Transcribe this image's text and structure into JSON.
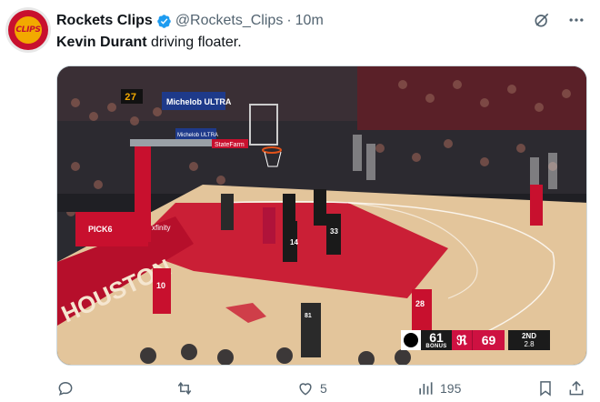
{
  "account": {
    "display_name": "Rockets Clips",
    "handle": "@Rockets_Clips",
    "separator": "·",
    "timestamp": "10m",
    "avatar_text": "CLIPS",
    "verified": true
  },
  "tweet": {
    "bold_text": "Kevin Durant",
    "rest_text": " driving floater."
  },
  "media": {
    "type": "video-frame",
    "arena_signs": {
      "sign1": "Michelob ULTRA",
      "sign2": "Michelob ULTRA",
      "sign3": "StateFarm",
      "shot_clock": "27",
      "baseline": "HOUSTON",
      "pick6": "PICK6",
      "sponsor_side": "xfinity"
    },
    "jerseys": [
      "10",
      "14",
      "33",
      "28",
      "81"
    ],
    "scorebug": {
      "away_score": "61",
      "away_bonus": "BONUS",
      "home_score": "69",
      "period": "2ND",
      "clock": "2.8"
    }
  },
  "actions": {
    "replies": "",
    "retweets": "",
    "likes": "5",
    "views": "195"
  },
  "colors": {
    "accent": "#1d9bf0",
    "muted": "#536471",
    "rockets_red": "#ce1141",
    "court_wood": "#e3c59b",
    "paint_red": "#c8102e"
  },
  "icons": [
    "verified-badge-icon",
    "grok-icon",
    "more-icon",
    "reply-icon",
    "retweet-icon",
    "like-icon",
    "views-icon",
    "bookmark-icon",
    "share-icon"
  ]
}
